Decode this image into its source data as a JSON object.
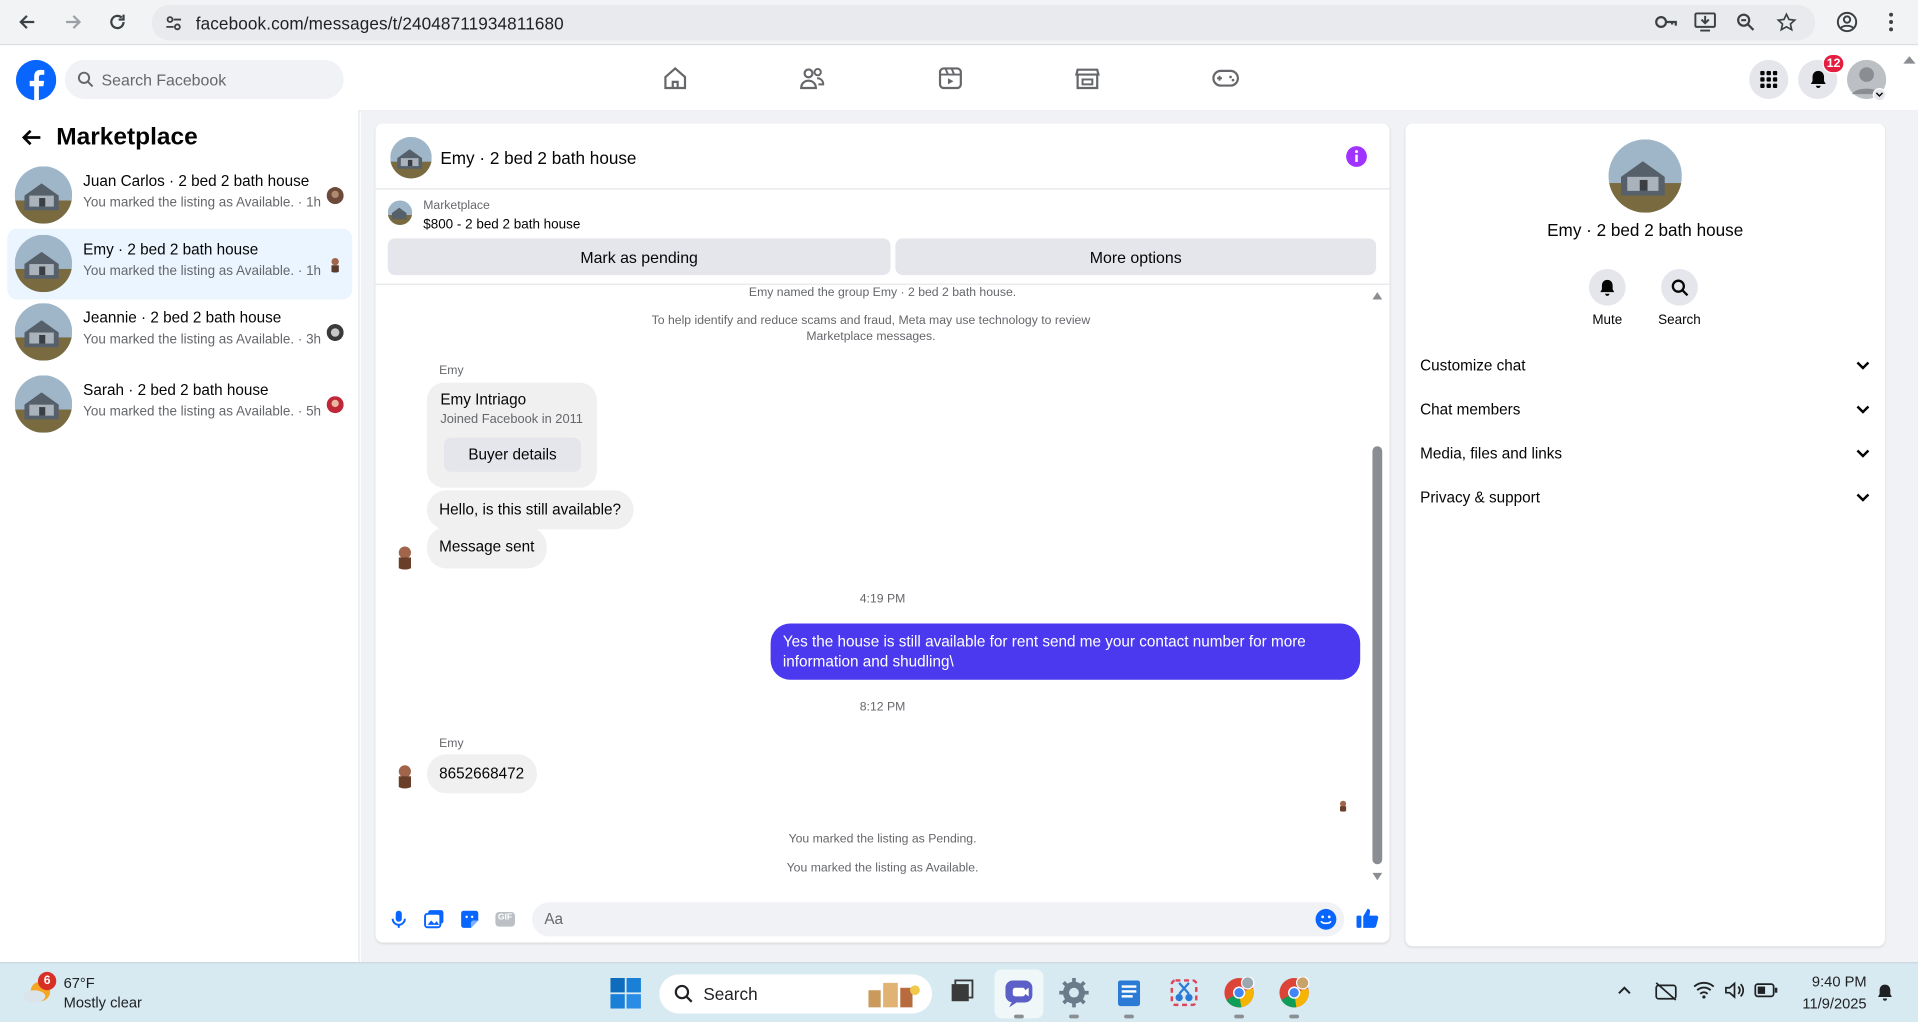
{
  "browser": {
    "url": "facebook.com/messages/t/24048711934811680"
  },
  "fb_header": {
    "search_placeholder": "Search Facebook",
    "notification_count": "12"
  },
  "left_panel": {
    "title": "Marketplace",
    "conversations": [
      {
        "name": "Juan Carlos · 2 bed 2 bath house",
        "subtitle": "You marked the listing as Available. · 1h",
        "active": false
      },
      {
        "name": "Emy · 2 bed 2 bath house",
        "subtitle": "You marked the listing as Available. · 1h",
        "active": true
      },
      {
        "name": "Jeannie · 2 bed 2 bath house",
        "subtitle": "You marked the listing as Available. · 3h",
        "active": false
      },
      {
        "name": "Sarah · 2 bed 2 bath house",
        "subtitle": "You marked the listing as Available. · 5h",
        "active": false
      }
    ]
  },
  "chat": {
    "title": "Emy · 2 bed 2 bath house",
    "listing": {
      "label": "Marketplace",
      "price_title": "$800 - 2 bed 2 bath house",
      "mark_pending": "Mark as pending",
      "more_options": "More options"
    },
    "system_top": "Emy named the group Emy · 2 bed 2 bath house.",
    "scam_notice": "To help identify and reduce scams and fraud, Meta may use technology to review Marketplace messages.",
    "sender_name": "Emy",
    "buyer_card": {
      "name": "Emy Intriago",
      "joined": "Joined Facebook in 2011",
      "button": "Buyer details"
    },
    "msg_available": "Hello, is this still available?",
    "msg_sent": "Message sent",
    "time_1": "4:19 PM",
    "my_message": "Yes the house is still available for rent send me your contact number for more information and shudling\\",
    "time_2": "8:12 PM",
    "sender_name_2": "Emy",
    "msg_number": "8652668472",
    "sys_pending": "You marked the listing as Pending.",
    "sys_available": "You marked the listing as Available.",
    "composer_placeholder": "Aa",
    "gif_label": "GIF"
  },
  "right_panel": {
    "title": "Emy · 2 bed 2 bath house",
    "mute_label": "Mute",
    "search_label": "Search",
    "sections": [
      "Customize chat",
      "Chat members",
      "Media, files and links",
      "Privacy & support"
    ]
  },
  "taskbar": {
    "weather_badge": "6",
    "temperature": "67°F",
    "weather_text": "Mostly clear",
    "search_label": "Search",
    "time": "9:40 PM",
    "date": "11/9/2025"
  },
  "colors": {
    "fb_blue": "#0866ff",
    "my_bubble": "#4b39ef",
    "info_purple": "#a033ff",
    "active_row": "#ebf5ff"
  }
}
